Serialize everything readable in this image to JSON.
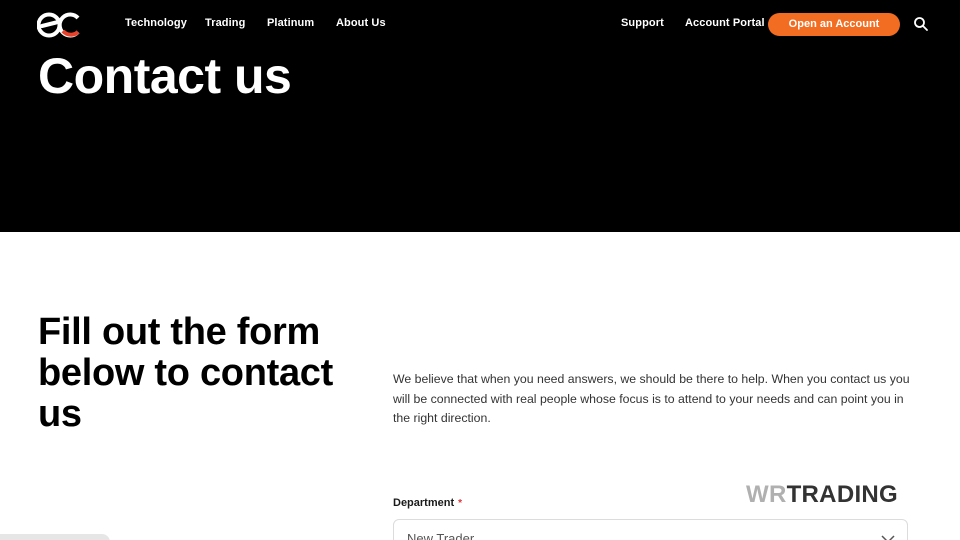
{
  "header": {
    "logo_icon": "ec-logo-icon",
    "nav": [
      {
        "label": "Technology"
      },
      {
        "label": "Trading"
      },
      {
        "label": "Platinum"
      },
      {
        "label": "About Us"
      }
    ],
    "right_links": [
      {
        "label": "Support"
      },
      {
        "label": "Account Portal"
      }
    ],
    "cta_label": "Open an Account",
    "search_icon": "search-icon"
  },
  "hero": {
    "title": "Contact us"
  },
  "form_section": {
    "heading": "Fill out the form below to contact us",
    "intro": "We believe that when you need answers, we should be there to help. When you contact us you will be connected with real people whose focus is to attend to your needs and can point you in the right direction.",
    "department": {
      "label": "Department",
      "required_mark": "*",
      "selected_value": "New Trader"
    },
    "brand": {
      "wr": "WR",
      "trading": "TRADING"
    }
  },
  "colors": {
    "accent": "#f26d21",
    "hero_bg": "#000000",
    "logo_red": "#e8412c"
  }
}
